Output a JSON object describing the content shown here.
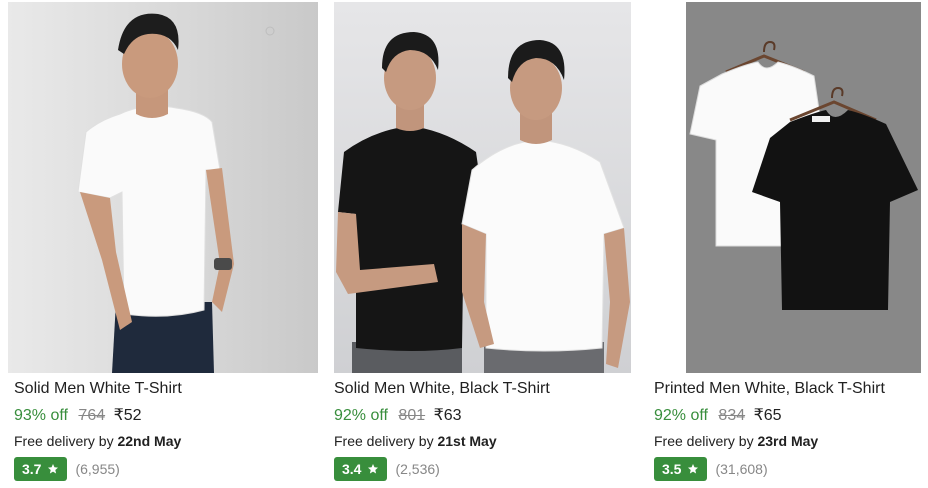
{
  "products": [
    {
      "title": "Solid Men White T-Shirt",
      "discount": "93% off",
      "mrp": "764",
      "price": "₹52",
      "delivery_prefix": "Free delivery by",
      "delivery_date": "22nd May",
      "rating": "3.7",
      "rating_count": "(6,955)"
    },
    {
      "title": "Solid Men White, Black T-Shirt",
      "discount": "92% off",
      "mrp": "801",
      "price": "₹63",
      "delivery_prefix": "Free delivery by",
      "delivery_date": "21st May",
      "rating": "3.4",
      "rating_count": "(2,536)"
    },
    {
      "title": "Printed Men White, Black T-Shirt",
      "discount": "92% off",
      "mrp": "834",
      "price": "₹65",
      "delivery_prefix": "Free delivery by",
      "delivery_date": "23rd May",
      "rating": "3.5",
      "rating_count": "(31,608)"
    }
  ],
  "colors": {
    "discount_green": "#388e3c",
    "rating_badge": "#388e3c",
    "muted_text": "#878787"
  },
  "icons": [
    "star-icon"
  ]
}
